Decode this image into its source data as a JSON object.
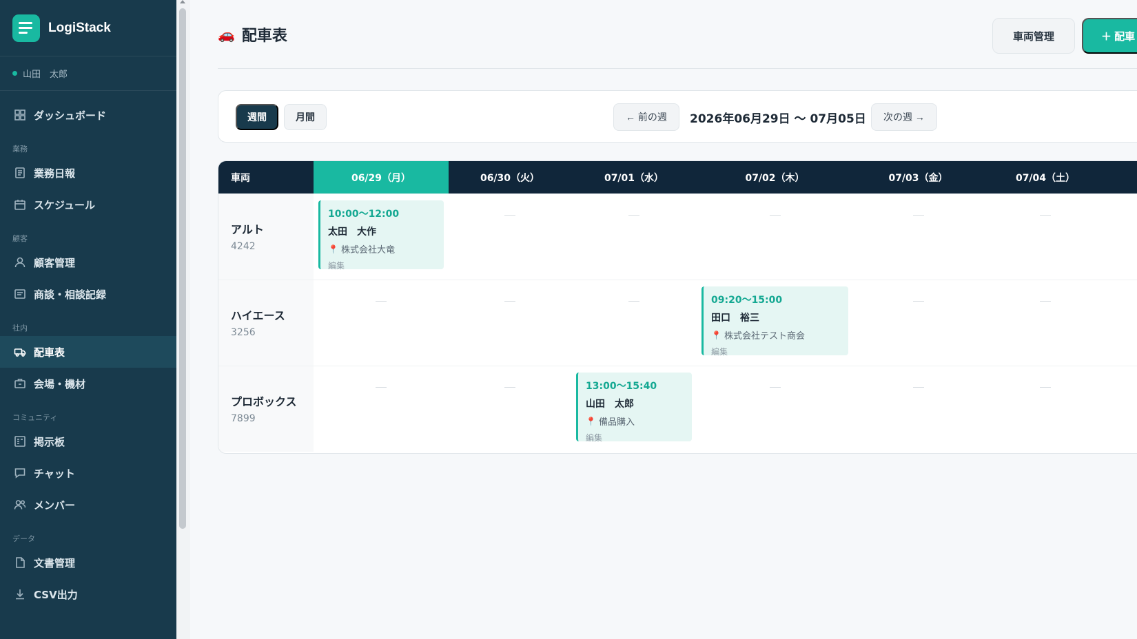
{
  "brand": {
    "name": "LogiStack",
    "icon": "menu-icon"
  },
  "user": {
    "name": "山田　太郎",
    "status_color": "#19b9a1"
  },
  "sidebar": {
    "items": [
      {
        "label": "ダッシュボード",
        "icon": "dashboard-icon"
      },
      {
        "section": "業務"
      },
      {
        "label": "業務日報",
        "icon": "report-icon"
      },
      {
        "label": "スケジュール",
        "icon": "calendar-icon"
      },
      {
        "section": "顧客"
      },
      {
        "label": "顧客管理",
        "icon": "user-icon"
      },
      {
        "label": "商談・相談記録",
        "icon": "note-icon"
      },
      {
        "section": "社内"
      },
      {
        "label": "配車表",
        "icon": "truck-icon",
        "active": true
      },
      {
        "label": "会場・機材",
        "icon": "briefcase-icon"
      },
      {
        "section": "コミュニティ"
      },
      {
        "label": "掲示板",
        "icon": "board-icon"
      },
      {
        "label": "チャット",
        "icon": "chat-icon"
      },
      {
        "label": "メンバー",
        "icon": "members-icon"
      },
      {
        "section": "データ"
      },
      {
        "label": "文書管理",
        "icon": "document-icon"
      },
      {
        "label": "CSV出力",
        "icon": "download-icon"
      }
    ]
  },
  "header": {
    "title": "配車表",
    "title_icon": "car-icon",
    "vehicle_button": "車両管理",
    "add_button": "＋ 配車"
  },
  "toolbar": {
    "week_label": "週間",
    "month_label": "月間",
    "prev_label": "← 前の週",
    "range": "2026年06月29日 〜 07月05日",
    "next_label": "次の週 →"
  },
  "grid": {
    "vehicle_header": "車両",
    "days": [
      {
        "label": "06/29（月）",
        "today": true
      },
      {
        "label": "06/30（火）"
      },
      {
        "label": "07/01（水）"
      },
      {
        "label": "07/02（木）"
      },
      {
        "label": "07/03（金）"
      },
      {
        "label": "07/04（土）"
      }
    ],
    "rows": [
      {
        "vehicle": "アルト",
        "number": "4242",
        "events": [
          {
            "day": 0,
            "time": "10:00〜12:00",
            "person": "太田　大作",
            "place": "株式会社大竜",
            "edit": "編集"
          }
        ]
      },
      {
        "vehicle": "ハイエース",
        "number": "3256",
        "events": [
          {
            "day": 3,
            "time": "09:20〜15:00",
            "person": "田口　裕三",
            "place": "株式会社テスト商会",
            "edit": "編集"
          }
        ]
      },
      {
        "vehicle": "プロボックス",
        "number": "7899",
        "events": [
          {
            "day": 2,
            "time": "13:00〜15:40",
            "person": "山田　太郎",
            "place": "備品購入",
            "edit": "編集"
          }
        ]
      }
    ]
  },
  "colors": {
    "accent": "#19b9a1",
    "sidebar": "#183a4c",
    "header": "#10263a"
  }
}
